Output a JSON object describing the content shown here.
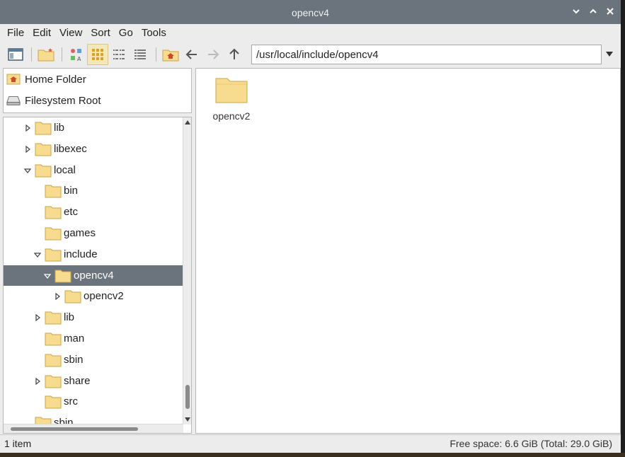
{
  "window": {
    "title": "opencv4",
    "controls": [
      "minimize",
      "maximize",
      "close"
    ]
  },
  "menu": [
    "File",
    "Edit",
    "View",
    "Sort",
    "Go",
    "Tools"
  ],
  "toolbar": {
    "buttons": [
      {
        "name": "new-window-icon"
      },
      {
        "name": "new-tab-icon"
      },
      {
        "name": "thumbnail-view-icon"
      },
      {
        "name": "icon-view-icon",
        "active": true
      },
      {
        "name": "compact-view-icon"
      },
      {
        "name": "detailed-list-icon"
      },
      {
        "name": "home-icon"
      },
      {
        "name": "back-icon"
      },
      {
        "name": "forward-icon"
      },
      {
        "name": "up-icon"
      }
    ],
    "path": "/usr/local/include/opencv4"
  },
  "places": [
    {
      "label": "Home Folder",
      "icon": "home-folder-icon"
    },
    {
      "label": "Filesystem Root",
      "icon": "drive-icon"
    }
  ],
  "tree": [
    {
      "label": "lib",
      "depth": 0,
      "expander": "collapsed"
    },
    {
      "label": "libexec",
      "depth": 0,
      "expander": "collapsed"
    },
    {
      "label": "local",
      "depth": 0,
      "expander": "expanded"
    },
    {
      "label": "bin",
      "depth": 1,
      "expander": "none"
    },
    {
      "label": "etc",
      "depth": 1,
      "expander": "none"
    },
    {
      "label": "games",
      "depth": 1,
      "expander": "none"
    },
    {
      "label": "include",
      "depth": 1,
      "expander": "expanded"
    },
    {
      "label": "opencv4",
      "depth": 2,
      "expander": "expanded",
      "selected": true
    },
    {
      "label": "opencv2",
      "depth": 3,
      "expander": "collapsed"
    },
    {
      "label": "lib",
      "depth": 1,
      "expander": "collapsed"
    },
    {
      "label": "man",
      "depth": 1,
      "expander": "none"
    },
    {
      "label": "sbin",
      "depth": 1,
      "expander": "none"
    },
    {
      "label": "share",
      "depth": 1,
      "expander": "collapsed"
    },
    {
      "label": "src",
      "depth": 1,
      "expander": "none"
    },
    {
      "label": "sbin",
      "depth": 0,
      "expander": "none"
    }
  ],
  "files": [
    {
      "name": "opencv2"
    }
  ],
  "status": {
    "items": "1 item",
    "free_space": "Free space: 6.6 GiB (Total: 29.0 GiB)"
  },
  "colors": {
    "titlebar": "#6b737c",
    "selection": "#6b737c",
    "folder_fill": "#f7dc8f",
    "folder_stroke": "#c9a445"
  }
}
